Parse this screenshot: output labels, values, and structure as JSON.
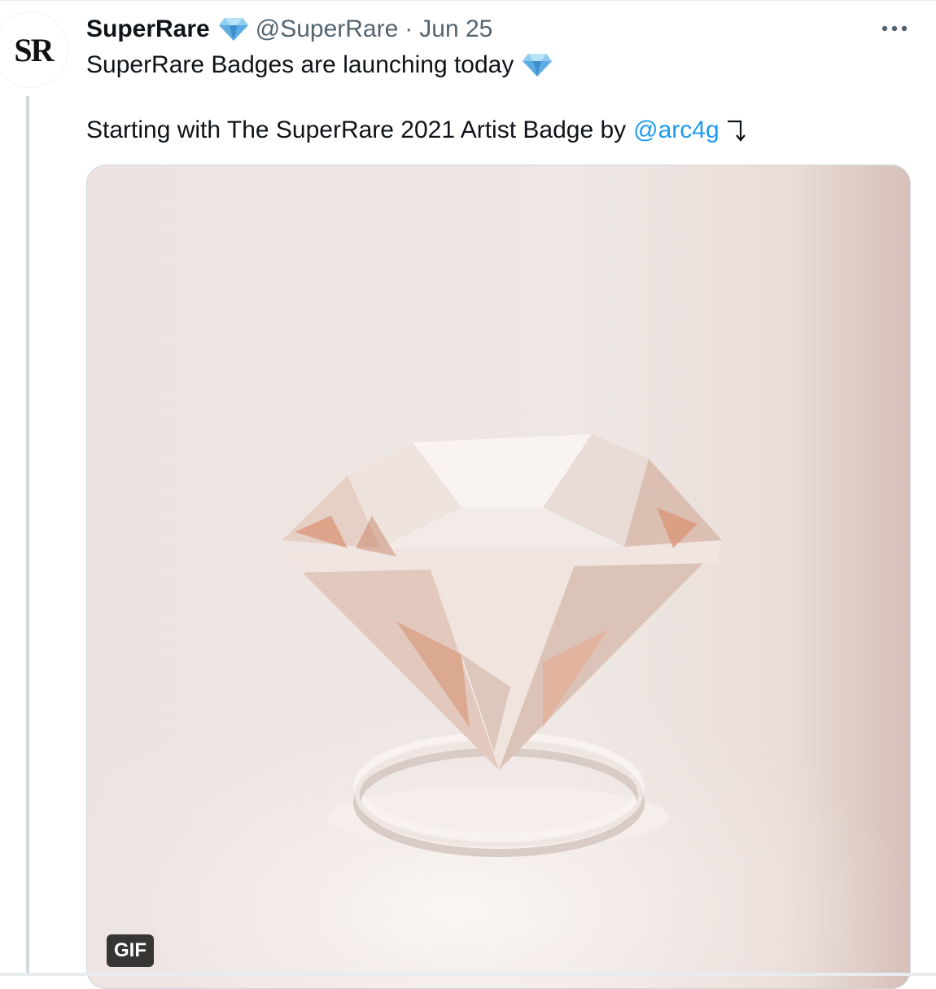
{
  "tweet": {
    "avatar_text": "SR",
    "display_name": "SuperRare",
    "handle": "@SuperRare",
    "separator": "·",
    "date": "Jun 25",
    "line1": "SuperRare Badges are launching today",
    "line2_prefix": "Starting with The SuperRare 2021 Artist Badge by",
    "mention": "@arc4g",
    "more_icon": "more-horizontal-icon",
    "verified_icon": "gem-emoji-icon",
    "arrow_icon": "down-right-arrow-icon"
  },
  "media": {
    "type": "gif",
    "badge_label": "GIF"
  },
  "colors": {
    "link": "#1d9bf0",
    "secondary_text": "#536471",
    "gem_blue": "#5dade2",
    "thread_line": "#cfd9de"
  }
}
